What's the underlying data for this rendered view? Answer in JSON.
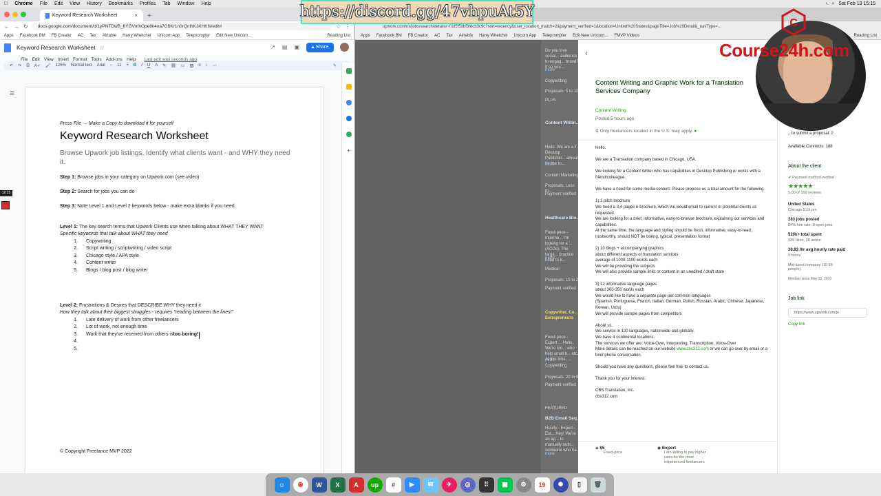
{
  "menubar": {
    "items": [
      "Chrome",
      "File",
      "Edit",
      "View",
      "History",
      "Bookmarks",
      "Profiles",
      "Tab",
      "Window",
      "Help"
    ],
    "clock": "Sat Feb 19  15:15"
  },
  "overlay": {
    "discord_url": "https://discord.gg/47vhpuAt5Y",
    "watermark": "Course24h.com",
    "time_badge": "12:15"
  },
  "left_browser": {
    "tab_title": "Keyword Research Worksheet",
    "address": "docs.google.com/document/d/1yPNTDwB_6YGVmhOpe8k4na7G6Kr1n0rQnlhKJXHKfs/edit#",
    "bookmarks": [
      "Apps",
      "Facebook BM",
      "FB Creator",
      "AC",
      "Tax",
      "Airtable",
      "Harry Whetchel",
      "Unicorn App",
      "Teleprompter",
      "Edit New Unicorn..."
    ],
    "reading_list": "Reading List"
  },
  "docs": {
    "title": "Keyword Research Worksheet",
    "menu": [
      "File",
      "Edit",
      "View",
      "Insert",
      "Format",
      "Tools",
      "Add-ons",
      "Help"
    ],
    "last_edit": "Last edit was seconds ago",
    "share": "Share",
    "toolbar": {
      "zoom": "125%",
      "style": "Normal text",
      "font": "Arial",
      "size": "11"
    }
  },
  "worksheet": {
    "press_file": "Press File → Make a Copy to download it for yourself",
    "heading": "Keyword Research Worksheet",
    "subtitle": "Browse Upwork job listings. Identify what clients want - and WHY they need it.",
    "step1_label": "Step 1:",
    "step1": " Browse jobs in your category on Upwork.com (see video)",
    "step2_label": "Step 2:",
    "step2": " Search for jobs you can do",
    "step3_label": "Step 3:",
    "step3": " Note Level 1 and Level 2 keywords below - make extra blanks if you need.",
    "level1_label": "Level 1:",
    "level1": " The key search terms that Upwork Clients use when talking about WHAT THEY WANT",
    "level1_sub": "Specific keywords that talk about WHAT they need",
    "level1_items": [
      "Copywriting",
      "Script writing / scriptwriting / video script",
      "Chicago style / APA style",
      "Content writer",
      "Blogs / blog post / blog writer"
    ],
    "level2_label": "Level 2:",
    "level2": " Frustrations & Desires that DESCRIBE WHY they need it",
    "level2_sub": "How they talk about their biggest struggles - requires \"reading between the lines!\"",
    "level2_items": [
      "Late delivery of work from other freelancers",
      "Lot of work, not enough time",
      "Work that they've received from others is ",
      "",
      ""
    ],
    "level2_bold": "too boring!",
    "copyright": "© Copyright Freelance MVP 2022"
  },
  "right_browser": {
    "address": "upwork.com/nx/jobs/search/details/~01f5f53bf3fdcb3c9c?sort=recency&user_location_match=2&payment_verified=1&location=United%20States&pageTitle=Job%20Detail&_navType=...",
    "bookmarks": [
      "Apps",
      "Facebook BM",
      "FB Creator",
      "AC",
      "Tax",
      "Airtable",
      "Harry Whetchel",
      "Unicorn App",
      "Teleprompter",
      "Edit New Unicorn...",
      "FMVP Videos"
    ],
    "reading_list": "Reading List"
  },
  "job_list": [
    {
      "text": "Do you love social... audience to engag... brand? If so you'...",
      "more": "more"
    },
    {
      "tag": "Copywriting",
      "proposals": "Proposals: 5 to 10"
    },
    {
      "badge": "PLUS",
      "verified": "Payme..."
    },
    {
      "title": "Content Writin..."
    },
    {
      "text": "Hello. We are a T... Desktop Publishin... amount for the to...",
      "more": "more"
    },
    {
      "tag": "Content Marketing",
      "proposals": "Proposals: Less th..."
    },
    {
      "verified": "Payment verified"
    },
    {
      "title": "Healthcare Blo..."
    },
    {
      "text": "Fixed-price - Interme... I'm looking for a ... (ACOs). The targe... practice need to k...",
      "more": "more"
    },
    {
      "tag": "Medical",
      "proposals": "Proposals: 15 to 20"
    },
    {
      "verified": "Payment verified"
    },
    {
      "title": "Copywriter, Co... Entrepreneurs"
    },
    {
      "text": "Fixed-price - Expert ... Hello, We're loo... who help small b... etc. At this time, ...",
      "more": "more"
    },
    {
      "tag": "Copywriting",
      "proposals": "Proposals: 20 to 50"
    },
    {
      "verified": "Payment verified"
    },
    {
      "badge": "FEATURED",
      "title": "B2B Email Seq..."
    },
    {
      "text": "Hourly - Expert - Est... Hey! We're an ag... to manually outb... someone who ha...",
      "more": "more"
    }
  ],
  "job": {
    "title": "Content Writing and Graphic Work for a Translation Services Company",
    "category": "Content Writing",
    "posted": "Posted 5 hours ago",
    "only_us": "Only freelancers located in the U.S. may apply.",
    "body": [
      "Hello.",
      "We are a Translation company based in Chicago, USA.",
      "We looking for a Content Writer who has capabilities in Desktop Publishing or works with a friend/colleague.",
      "We have a need for some media content. Please propose us a total amount for the following.",
      "1) 1 pitch brochure\nWe need a 3-4 pages e-brochure, which we would email to current or potential clients as requested.\nWe are looking for a brief, informative, easy-to-browse brochure, explaining our services and capabilities.\nAt the same time, the language and styling should be fresh, informative, easy-to-read, trustworthy, should NOT be boring, typical, presentation format",
      "2) 10 blogs + accompanying graphics\nabout different aspects of translation services\naverage of 1000-1100 words each\nWe will be providing the subjects\nWe will also provide sample links or content in an unedited / draft state",
      "3) 12 informative language pages\nabout 300-350 words each\nWe would like to have a separate page per common languages\n(Spanish, Portuguese, French, Italian, German, Polish, Russian, Arabic, Chinese, Japanese, Korean, Urdu)\nWe will provide sample pages from competitors",
      "About us..\nWe service in 120 languages, nationwide and globally.\nWe have 4 continental locations.\nThe services we offer are: Voice-Over, Interpreting, Transcription, Voice-Over",
      "Should you have any questions, please feel free to contact us.",
      "Thank you for your interest.",
      "CBS Translation, Inc.\ncbs312.com"
    ],
    "details_prefix": "More details can be reached on our website ",
    "details_link": "www.cbs312.com",
    "details_suffix": " or we can go over by email or a brief phone conversation.",
    "price": "$5",
    "price_type": "Fixed-price",
    "level": "Expert",
    "level_desc": "I am willing to pay higher rates for the most experienced freelancers"
  },
  "sidebar": {
    "submit_text": "...to submit a proposal: 2",
    "connects": "Available Connects: 188",
    "about": "About the client",
    "payment": "Payment method verified",
    "stars": "★★★★★",
    "reviews": "5.00 of 169 reviews",
    "country": "United States",
    "city": "Chicago 2:15 pm",
    "jobs_posted": "283 jobs posted",
    "hire_rate": "84% hire rate, 8 open jobs",
    "spent": "$20k+ total spent",
    "hires": "239 hires, 20 active",
    "rate": "38.93 /hr avg hourly rate paid",
    "hours": "5 hours",
    "company": "Mid-sized company (10-99 people)",
    "member": "Member since May 13, 2019",
    "job_link": "Job link",
    "job_link_value": "https://www.upwork.com/jo",
    "copy_link": "Copy link"
  },
  "colors": {
    "upwork_green": "#14a800",
    "docs_blue": "#1a73e8",
    "watermark_red": "#d0151a",
    "discord_border": "#3ee5c8"
  }
}
